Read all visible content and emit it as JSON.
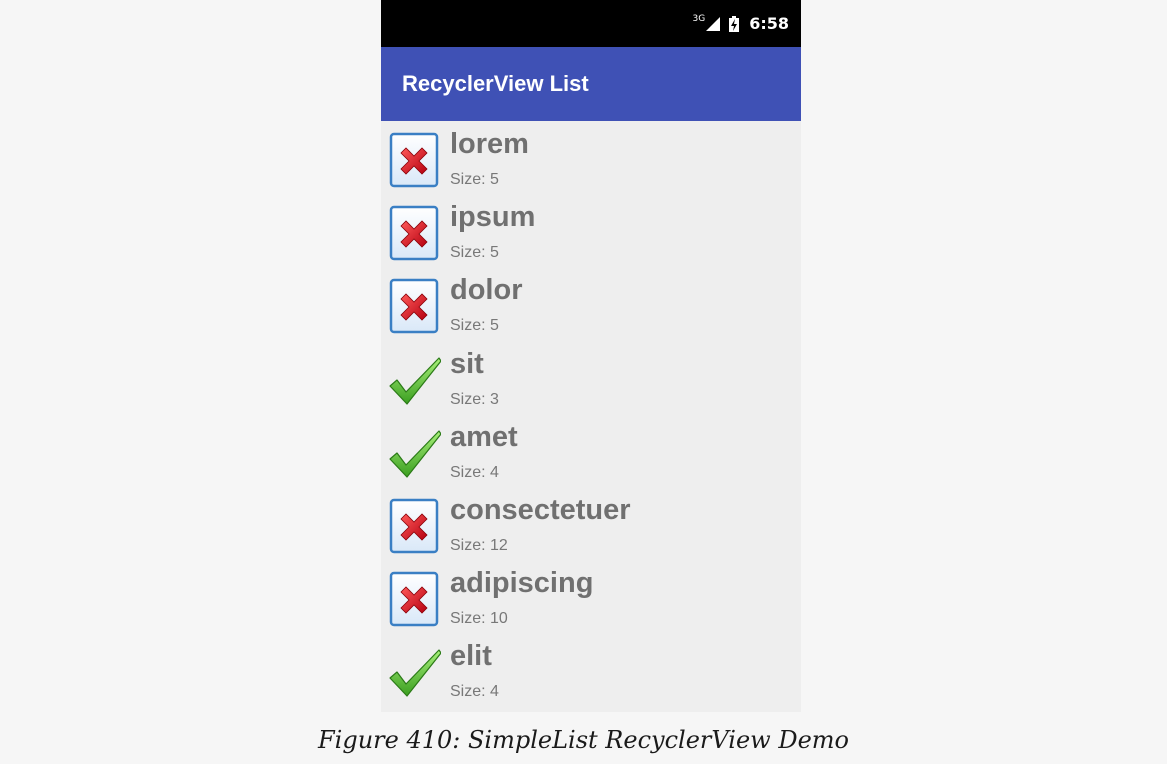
{
  "status_bar": {
    "network": "3G",
    "time": "6:58"
  },
  "toolbar": {
    "title": "RecyclerView List"
  },
  "items": [
    {
      "title": "lorem",
      "size": "Size: 5",
      "icon": "cross-icon"
    },
    {
      "title": "ipsum",
      "size": "Size: 5",
      "icon": "cross-icon"
    },
    {
      "title": "dolor",
      "size": "Size: 5",
      "icon": "cross-icon"
    },
    {
      "title": "sit",
      "size": "Size: 3",
      "icon": "check-icon"
    },
    {
      "title": "amet",
      "size": "Size: 4",
      "icon": "check-icon"
    },
    {
      "title": "consectetuer",
      "size": "Size: 12",
      "icon": "cross-icon"
    },
    {
      "title": "adipiscing",
      "size": "Size: 10",
      "icon": "cross-icon"
    },
    {
      "title": "elit",
      "size": "Size: 4",
      "icon": "check-icon"
    }
  ],
  "caption": "Figure 410: SimpleList RecyclerView Demo",
  "colors": {
    "toolbar": "#3f51b5",
    "list_background": "#eeeeee",
    "cross": "#e0141a",
    "check": "#5ec635",
    "icon_frame": "#3a7fc4"
  }
}
